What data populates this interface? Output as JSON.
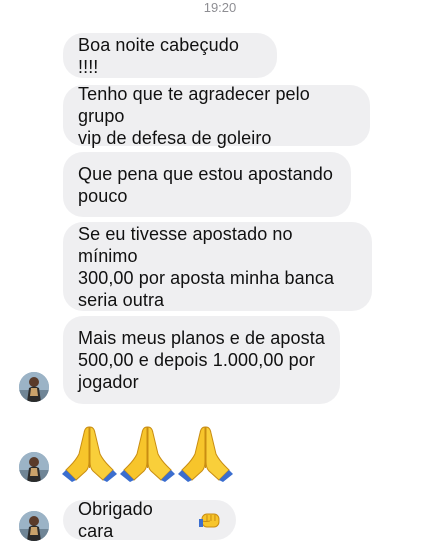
{
  "timestamp": "19:20",
  "messages": [
    {
      "text": "Boa noite cabeçudo !!!!"
    },
    {
      "text": "Tenho que te agradecer pelo grupo\nvip de defesa de goleiro"
    },
    {
      "text": "Que pena que estou apostando\npouco"
    },
    {
      "text": "Se eu tivesse apostado no mínimo\n300,00 por aposta minha banca\nseria outra"
    },
    {
      "text": "Mais meus planos e de aposta\n500,00 e depois 1.000,00 por\njogador"
    },
    {
      "text": "Obrigado cara"
    }
  ],
  "emoji_message": {
    "icons": [
      "folded-hands-icon",
      "folded-hands-icon",
      "folded-hands-icon"
    ]
  },
  "last_message_emoji": "oncoming-fist-icon",
  "colors": {
    "bubble": "#efeff1",
    "timestamp": "#8e8e93",
    "emoji_skin": "#f7c52b",
    "emoji_sleeve": "#3b6ecf"
  }
}
